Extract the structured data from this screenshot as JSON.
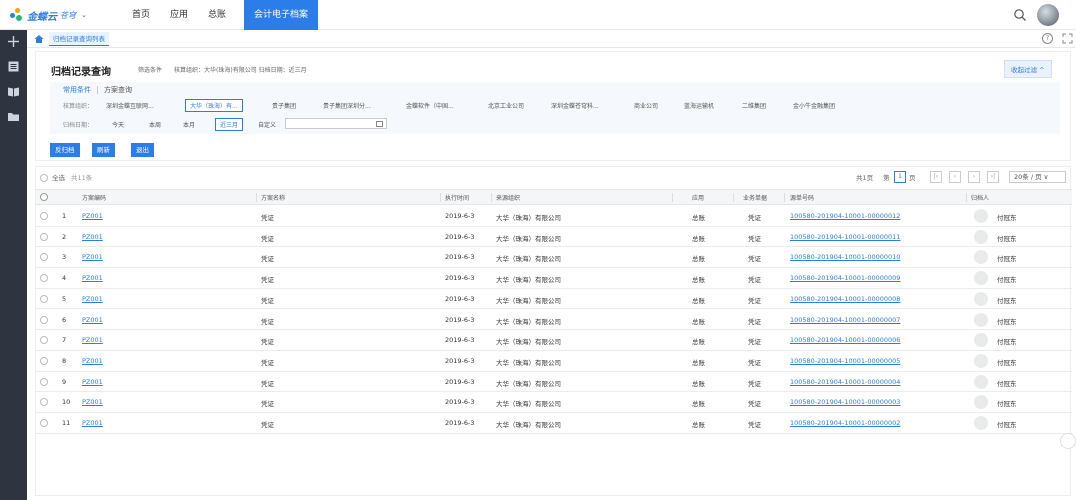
{
  "app": {
    "brand": "金蝶云",
    "brand_sub": "苍穹",
    "caret": "⌄",
    "nav": [
      "首页",
      "应用",
      "总账"
    ],
    "active_nav": "会计电子档案"
  },
  "breadcrumb": {
    "current": "归档记录查询列表"
  },
  "filter_panel": {
    "title": "归档记录查询",
    "criteria_label": "筛选条件",
    "criteria_org": "核算组织：大华(珠海)有限公司",
    "criteria_date": "归档日期：近三月",
    "collapse_label": "收起过滤 ^",
    "tabs": [
      "常用条件",
      "方案查询"
    ],
    "org_label": "核算组织：",
    "org_options": [
      "深圳金蝶互联网...",
      "大华（珠海）有...",
      "贵子集团",
      "贵子集团深圳分...",
      "金蝶软件（中国...",
      "北京工业公司",
      "深圳金蝶苍穹科...",
      "商业公司",
      "蓝海运输机",
      "二维集团",
      "金小牛金融集团"
    ],
    "date_label": "归档日期：",
    "date_options": [
      "今天",
      "本周",
      "本月",
      "近三月",
      "自定义"
    ],
    "buttons": [
      "反归档",
      "刷新",
      "退出"
    ]
  },
  "table": {
    "select_all": "全选",
    "total": "共11条",
    "pager": {
      "total_pages": "共1页",
      "page_prefix": "第",
      "page": "1",
      "page_suffix": "页",
      "page_size": "20条 / 页 ∨"
    },
    "columns": [
      "方案编码",
      "方案名称",
      "执行时间",
      "来源组织",
      "应用",
      "业务单据",
      "源单号码",
      "归档人"
    ],
    "rows": [
      {
        "no": "1",
        "code": "PZ001",
        "name": "凭证",
        "time": "2019-6-3",
        "org": "大华（珠海）有限公司",
        "app": "总账",
        "doc": "凭证",
        "src": "100580-201904-10001-00000012",
        "user": "付冠东"
      },
      {
        "no": "2",
        "code": "PZ001",
        "name": "凭证",
        "time": "2019-6-3",
        "org": "大华（珠海）有限公司",
        "app": "总账",
        "doc": "凭证",
        "src": "100580-201904-10001-00000011",
        "user": "付冠东"
      },
      {
        "no": "3",
        "code": "PZ001",
        "name": "凭证",
        "time": "2019-6-3",
        "org": "大华（珠海）有限公司",
        "app": "总账",
        "doc": "凭证",
        "src": "100580-201904-10001-00000010",
        "user": "付冠东"
      },
      {
        "no": "4",
        "code": "PZ001",
        "name": "凭证",
        "time": "2019-6-3",
        "org": "大华（珠海）有限公司",
        "app": "总账",
        "doc": "凭证",
        "src": "100580-201904-10001-00000009",
        "user": "付冠东"
      },
      {
        "no": "5",
        "code": "PZ001",
        "name": "凭证",
        "time": "2019-6-3",
        "org": "大华（珠海）有限公司",
        "app": "总账",
        "doc": "凭证",
        "src": "100580-201904-10001-00000008",
        "user": "付冠东"
      },
      {
        "no": "6",
        "code": "PZ001",
        "name": "凭证",
        "time": "2019-6-3",
        "org": "大华（珠海）有限公司",
        "app": "总账",
        "doc": "凭证",
        "src": "100580-201904-10001-00000007",
        "user": "付冠东"
      },
      {
        "no": "7",
        "code": "PZ001",
        "name": "凭证",
        "time": "2019-6-3",
        "org": "大华（珠海）有限公司",
        "app": "总账",
        "doc": "凭证",
        "src": "100580-201904-10001-00000006",
        "user": "付冠东"
      },
      {
        "no": "8",
        "code": "PZ001",
        "name": "凭证",
        "time": "2019-6-3",
        "org": "大华（珠海）有限公司",
        "app": "总账",
        "doc": "凭证",
        "src": "100580-201904-10001-00000005",
        "user": "付冠东"
      },
      {
        "no": "9",
        "code": "PZ001",
        "name": "凭证",
        "time": "2019-6-3",
        "org": "大华（珠海）有限公司",
        "app": "总账",
        "doc": "凭证",
        "src": "100580-201904-10001-00000004",
        "user": "付冠东"
      },
      {
        "no": "10",
        "code": "PZ001",
        "name": "凭证",
        "time": "2019-6-3",
        "org": "大华（珠海）有限公司",
        "app": "总账",
        "doc": "凭证",
        "src": "100580-201904-10001-00000003",
        "user": "付冠东"
      },
      {
        "no": "11",
        "code": "PZ001",
        "name": "凭证",
        "time": "2019-6-3",
        "org": "大华（珠海）有限公司",
        "app": "总账",
        "doc": "凭证",
        "src": "100580-201904-10001-00000002",
        "user": "付冠东"
      }
    ]
  },
  "colors": {
    "accent": "#2b7de9",
    "rail": "#2e3440",
    "panel_bg": "#f5f8fc"
  },
  "icons": [
    "search-icon",
    "user-avatar",
    "add-icon",
    "list-icon",
    "book-icon",
    "folder-icon",
    "home-icon",
    "help-icon",
    "fullscreen-icon",
    "calendar-icon"
  ]
}
